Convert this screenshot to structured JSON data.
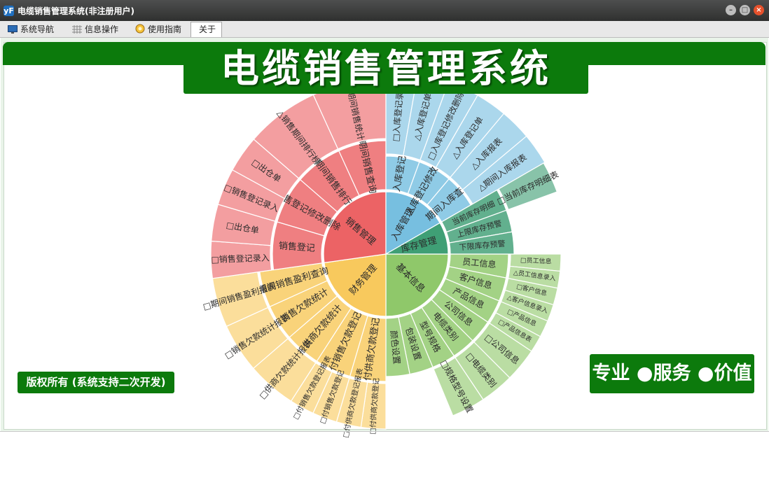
{
  "window": {
    "title": "电缆销售管理系统(非注册用户)",
    "app_icon": "yF",
    "icons": {
      "app": "app-logo-icon",
      "minimize": "minimize-icon",
      "maximize": "maximize-icon",
      "close": "close-icon"
    }
  },
  "tabs": [
    {
      "label": "系统导航",
      "icon": "monitor-icon",
      "active": false
    },
    {
      "label": "信息操作",
      "icon": "grid-icon",
      "active": false
    },
    {
      "label": "使用指南",
      "icon": "guide-icon",
      "active": false
    },
    {
      "label": "关于",
      "icon": "",
      "active": true
    }
  ],
  "banner": {
    "title": "电缆销售管理系统"
  },
  "copyright": "版权所有 (系统支持二次开发)",
  "slogan": "专业 ●服务 ●价值",
  "colors": {
    "brand_green": "#0c7a0c",
    "sunburst": [
      "#8fc86a",
      "#f8c95d",
      "#ec6365",
      "#77bfe0",
      "#3f9f75"
    ]
  },
  "chart_data": {
    "type": "sunburst",
    "root": [
      {
        "name": "基本信息",
        "color": "#8fc86a",
        "start": 90,
        "end": 180,
        "children": [
          {
            "name": "员工信息",
            "children": [
              {
                "name": "□员工信息"
              },
              {
                "name": "△员工信息录入"
              }
            ]
          },
          {
            "name": "客户信息",
            "children": [
              {
                "name": "□客户信息"
              },
              {
                "name": "△客户信息录入"
              }
            ]
          },
          {
            "name": "产品信息",
            "children": [
              {
                "name": "□产品信息"
              },
              {
                "name": "□产品信息表"
              }
            ]
          },
          {
            "name": "公司信息",
            "children": [
              {
                "name": "□公司信息"
              }
            ]
          },
          {
            "name": "电缆类别",
            "children": [
              {
                "name": "□电缆类别"
              }
            ]
          },
          {
            "name": "型号规格",
            "children": [
              {
                "name": "□规格型号设置"
              }
            ]
          },
          {
            "name": "包装设置",
            "children": []
          },
          {
            "name": "颜色设置",
            "children": []
          }
        ]
      },
      {
        "name": "财务管理",
        "color": "#f8c95d",
        "start": 180,
        "end": 262,
        "children": [
          {
            "name": "付供商欠款登记",
            "children": [
              {
                "name": "□付供商欠款登记"
              },
              {
                "name": "□付供商欠款登记报表"
              }
            ]
          },
          {
            "name": "付销售欠款登记",
            "children": [
              {
                "name": "□付销售欠款登记"
              },
              {
                "name": "□付销售欠款登记报表"
              }
            ]
          },
          {
            "name": "供商欠款统计",
            "children": [
              {
                "name": "□供商欠款统计报表"
              }
            ]
          },
          {
            "name": "销售欠款统计",
            "children": [
              {
                "name": "□销售欠款统计报表"
              }
            ]
          },
          {
            "name": "期间销售盈利查询",
            "children": [
              {
                "name": "□期间销售盈利报表"
              }
            ]
          }
        ]
      },
      {
        "name": "销售管理",
        "color": "#ec6365",
        "start": 262,
        "end": 360,
        "children": [
          {
            "name": "销售登记",
            "children": [
              {
                "name": "□销售登记录入"
              },
              {
                "name": "□出仓单"
              }
            ]
          },
          {
            "name": "销售登记修改删除",
            "children": [
              {
                "name": "□销售登记录入"
              },
              {
                "name": "□出仓单"
              }
            ]
          },
          {
            "name": "期间销售排行",
            "children": [
              {
                "name": "△销售期间排行榜"
              }
            ]
          },
          {
            "name": "期间销售查询",
            "children": [
              {
                "name": "□期间销售统计"
              }
            ]
          }
        ]
      },
      {
        "name": "入库管理",
        "color": "#77bfe0",
        "start": 0,
        "end": 60,
        "children": [
          {
            "name": "入库登记",
            "children": [
              {
                "name": "□入库登记录入"
              },
              {
                "name": "△入库登记单"
              }
            ]
          },
          {
            "name": "入库登记修改删除",
            "children": [
              {
                "name": "□入库登记修改删除"
              },
              {
                "name": "△入库登记单"
              }
            ]
          },
          {
            "name": "期间入库查询",
            "children": [
              {
                "name": "△入库报表"
              },
              {
                "name": "△期间入库报表"
              }
            ]
          }
        ]
      },
      {
        "name": "库存管理",
        "color": "#3f9f75",
        "start": 60,
        "end": 90,
        "children": [
          {
            "name": "当前库存明细",
            "children": [
              {
                "name": "□当前库存明细表"
              }
            ]
          },
          {
            "name": "上限库存预警",
            "children": []
          },
          {
            "name": "下限库存预警",
            "children": []
          }
        ]
      }
    ]
  }
}
